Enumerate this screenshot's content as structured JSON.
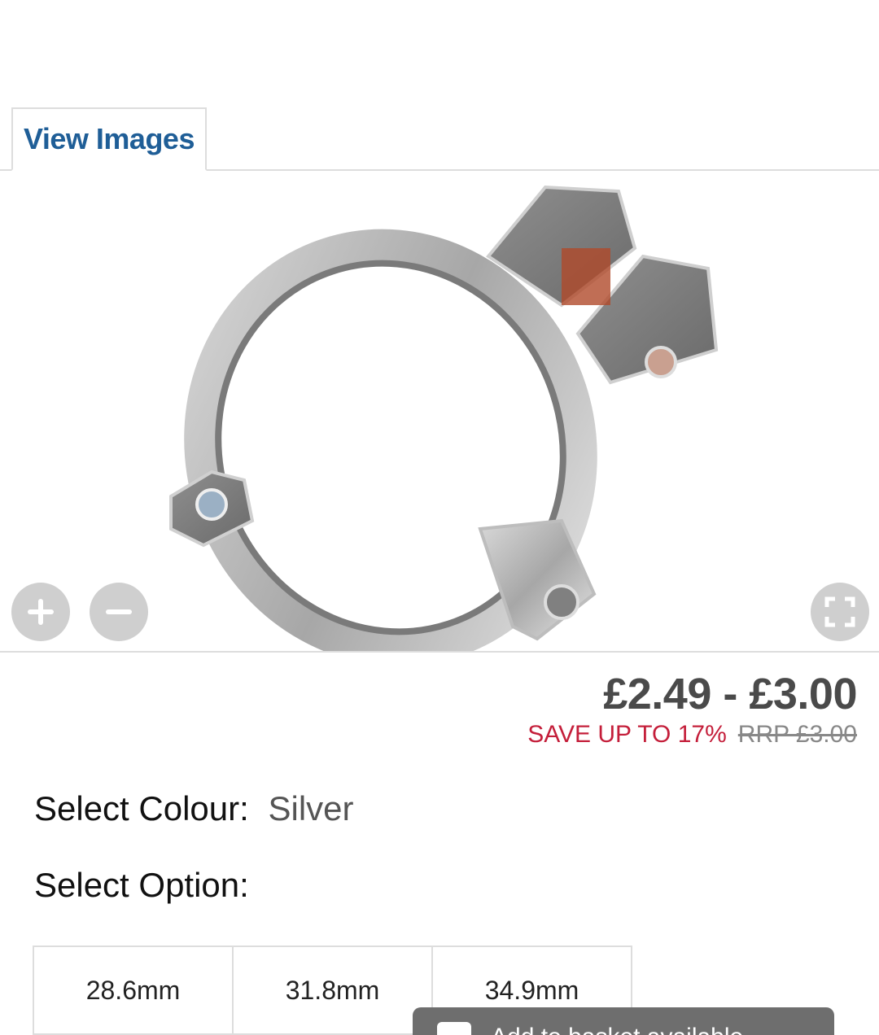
{
  "tabs": {
    "view_images": "View Images"
  },
  "viewer": {
    "zoom_in_icon": "plus-icon",
    "zoom_out_icon": "minus-icon",
    "fullscreen_icon": "expand-icon",
    "image_alt": "Silver frame clamp"
  },
  "price": {
    "range": "£2.49 - £3.00",
    "save": "SAVE UP TO 17%",
    "rrp": "RRP £3.00"
  },
  "colour": {
    "label": "Select Colour:",
    "value": "Silver"
  },
  "option": {
    "label": "Select Option:"
  },
  "options": [
    "28.6mm",
    "31.8mm",
    "34.9mm"
  ],
  "toast": {
    "text": "Add to basket available"
  },
  "colors": {
    "accent": "#1f5e97",
    "sale": "#c41e3a",
    "price": "#4a4a4a"
  }
}
